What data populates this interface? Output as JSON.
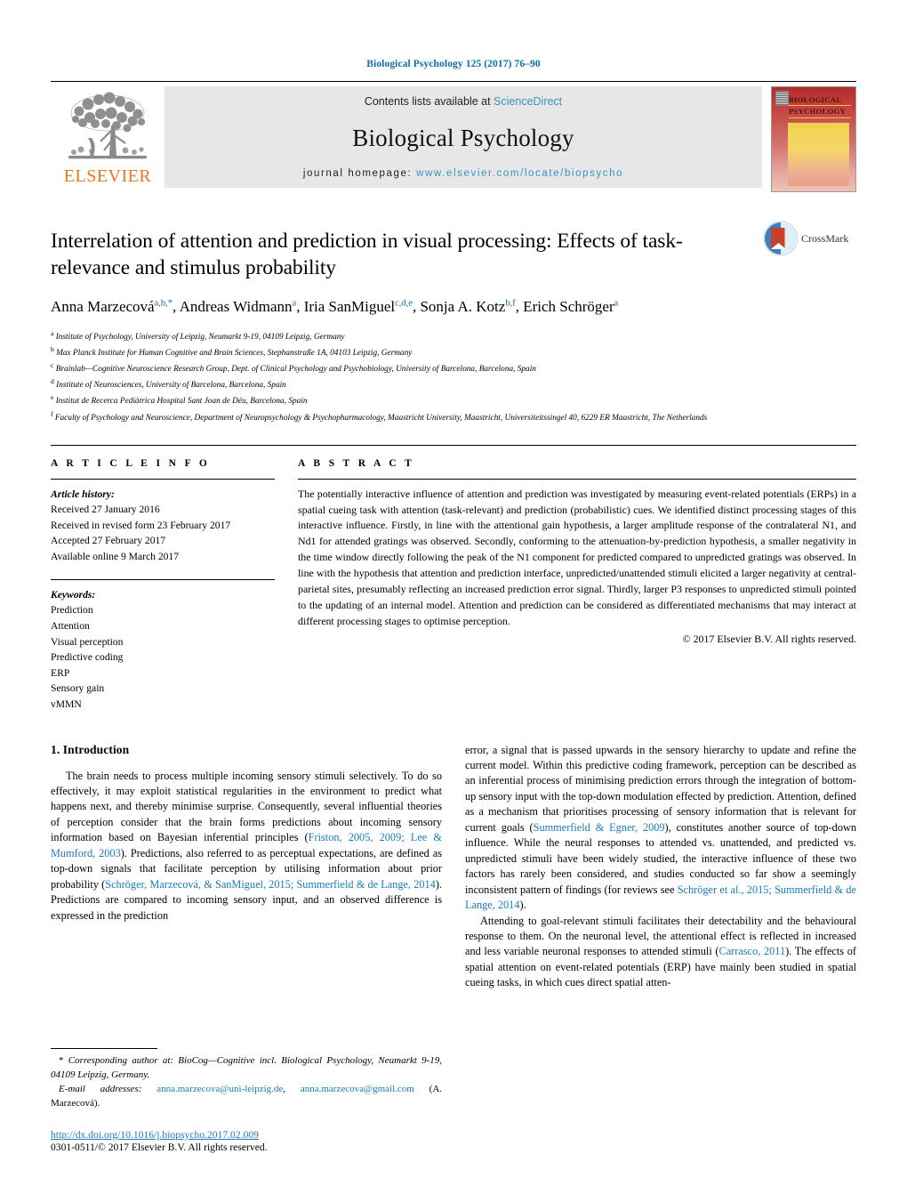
{
  "running_head": "Biological Psychology 125 (2017) 76–90",
  "masthead": {
    "publisher_logo_text": "ELSEVIER",
    "contents_prefix": "Contents lists available at ",
    "contents_link": "ScienceDirect",
    "journal_title": "Biological Psychology",
    "homepage_prefix": "journal homepage: ",
    "homepage_url": "www.elsevier.com/locate/biopsycho",
    "cover_line1": "BIOLOGICAL",
    "cover_line2": "PSYCHOLOGY"
  },
  "article": {
    "title": "Interrelation of attention and prediction in visual processing: Effects of task-relevance and stimulus probability",
    "crossmark_label": "CrossMark",
    "authors": [
      {
        "name": "Anna Marzecová",
        "sup": "a,b,*"
      },
      {
        "name": "Andreas Widmann",
        "sup": "a"
      },
      {
        "name": "Iria SanMiguel",
        "sup": "c,d,e"
      },
      {
        "name": "Sonja A. Kotz",
        "sup": "b,f"
      },
      {
        "name": "Erich Schröger",
        "sup": "a"
      }
    ],
    "affiliations": [
      {
        "mark": "a",
        "text": "Institute of Psychology, University of Leipzig, Neumarkt 9-19, 04109 Leipzig, Germany"
      },
      {
        "mark": "b",
        "text": "Max Planck Institute for Human Cognitive and Brain Sciences, Stephanstraße 1A, 04103 Leipzig, Germany"
      },
      {
        "mark": "c",
        "text": "Brainlab—Cognitive Neuroscience Research Group, Dept. of Clinical Psychology and Psychobiology, University of Barcelona, Barcelona, Spain"
      },
      {
        "mark": "d",
        "text": "Institute of Neurosciences, University of Barcelona, Barcelona, Spain"
      },
      {
        "mark": "e",
        "text": "Institut de Recerca Pediàtrica Hospital Sant Joan de Déu, Barcelona, Spain"
      },
      {
        "mark": "f",
        "text": "Faculty of Psychology and Neuroscience, Department of Neuropsychology & Psychopharmacology, Maastricht University, Maastricht, Universiteitssingel 40, 6229 ER Maastricht, The Netherlands"
      }
    ]
  },
  "article_info": {
    "heading": "A R T I C L E   I N F O",
    "history_label": "Article history:",
    "history": [
      "Received 27 January 2016",
      "Received in revised form 23 February 2017",
      "Accepted 27 February 2017",
      "Available online 9 March 2017"
    ],
    "keywords_label": "Keywords:",
    "keywords": [
      "Prediction",
      "Attention",
      "Visual perception",
      "Predictive coding",
      "ERP",
      "Sensory gain",
      "vMMN"
    ]
  },
  "abstract": {
    "heading": "A B S T R A C T",
    "text": "The potentially interactive influence of attention and prediction was investigated by measuring event-related potentials (ERPs) in a spatial cueing task with attention (task-relevant) and prediction (probabilistic) cues. We identified distinct processing stages of this interactive influence. Firstly, in line with the attentional gain hypothesis, a larger amplitude response of the contralateral N1, and Nd1 for attended gratings was observed. Secondly, conforming to the attenuation-by-prediction hypothesis, a smaller negativity in the time window directly following the peak of the N1 component for predicted compared to unpredicted gratings was observed. In line with the hypothesis that attention and prediction interface, unpredicted/unattended stimuli elicited a larger negativity at central-parietal sites, presumably reflecting an increased prediction error signal. Thirdly, larger P3 responses to unpredicted stimuli pointed to the updating of an internal model. Attention and prediction can be considered as differentiated mechanisms that may interact at different processing stages to optimise perception.",
    "copyright": "© 2017 Elsevier B.V. All rights reserved."
  },
  "body": {
    "section_heading": "1. Introduction",
    "left_para_1": {
      "part1": "The brain needs to process multiple incoming sensory stimuli selectively. To do so effectively, it may exploit statistical regularities in the environment to predict what happens next, and thereby minimise surprise. Consequently, several influential theories of perception consider that the brain forms predictions about incoming sensory information based on Bayesian inferential principles (",
      "cite1": "Friston, 2005, 2009; Lee & Mumford, 2003",
      "part2": "). Predictions, also referred to as perceptual expectations, are defined as top-down signals that facilitate perception by utilising information about prior probability (",
      "cite2": "Schröger, Marzecová, & SanMiguel, 2015; Summerfield & de Lange, 2014",
      "part3": "). Predictions are compared to incoming sensory input, and an observed difference is expressed in the prediction"
    },
    "right_para_1": {
      "part1": "error, a signal that is passed upwards in the sensory hierarchy to update and refine the current model. Within this predictive coding framework, perception can be described as an inferential process of minimising prediction errors through the integration of bottom-up sensory input with the top-down modulation effected by prediction. Attention, defined as a mechanism that prioritises processing of sensory information that is relevant for current goals (",
      "cite1": "Summerfield & Egner, 2009",
      "part2": "), constitutes another source of top-down influence. While the neural responses to attended vs. unattended, and predicted vs. unpredicted stimuli have been widely studied, the interactive influence of these two factors has rarely been considered, and studies conducted so far show a seemingly inconsistent pattern of findings (for reviews see ",
      "cite2": "Schröger et al., 2015; Summerfield & de Lange, 2014",
      "part3": ")."
    },
    "right_para_2": {
      "part1": "Attending to goal-relevant stimuli facilitates their detectability and the behavioural response to them. On the neuronal level, the attentional effect is reflected in increased and less variable neuronal responses to attended stimuli (",
      "cite1": "Carrasco, 2011",
      "part2": "). The effects of spatial attention on event-related potentials (ERP) have mainly been studied in spatial cueing tasks, in which cues direct spatial atten-"
    }
  },
  "footnote": {
    "star": "*",
    "corresponding": "Corresponding author at: BioCog—Cognitive incl. Biological Psychology, Neumarkt 9-19, 04109 Leipzig, Germany.",
    "email_label": "E-mail addresses:",
    "email1": "anna.marzecova@uni-leipzig.de",
    "email_sep": ", ",
    "email2": "anna.marzecova@gmail.com",
    "email_owner": "(A. Marzecová).",
    "doi": "http://dx.doi.org/10.1016/j.biopsycho.2017.02.009",
    "issn": "0301-0511/© 2017 Elsevier B.V. All rights reserved."
  },
  "colors": {
    "link_blue": "#1a7bb9",
    "header_blue": "#0b6ea8",
    "elsevier_orange": "#e87722",
    "banner_grey": "#e7e7e7"
  }
}
